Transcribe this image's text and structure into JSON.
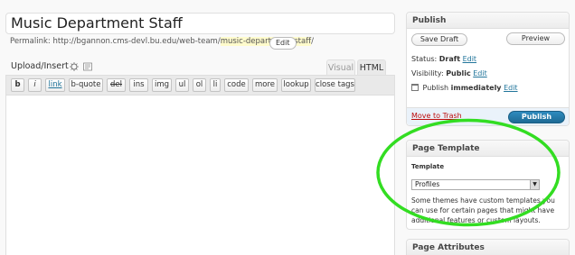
{
  "post": {
    "title": "Music Department Staff",
    "permalink_label": "Permalink:",
    "permalink_base": "http://bgannon.cms-devl.bu.edu/web-team/",
    "permalink_slug": "music-department-staff",
    "permalink_trailing": "/",
    "permalink_edit": "Edit"
  },
  "editor": {
    "upload_label": "Upload/Insert",
    "tabs": [
      "Visual",
      "HTML"
    ],
    "active_tab": "HTML",
    "quicktags": [
      "b",
      "i",
      "link",
      "b-quote",
      "del",
      "ins",
      "img",
      "ul",
      "ol",
      "li",
      "code",
      "more",
      "lookup",
      "close tags"
    ]
  },
  "publish": {
    "heading": "Publish",
    "save_draft": "Save Draft",
    "preview": "Preview",
    "status_label": "Status:",
    "status_value": "Draft",
    "visibility_label": "Visibility:",
    "visibility_value": "Public",
    "schedule_prefix": "Publish",
    "schedule_value": "immediately",
    "edit": "Edit",
    "trash": "Move to Trash",
    "publish_button": "Publish"
  },
  "page_template": {
    "heading": "Page Template",
    "label": "Template",
    "selected": "Profiles",
    "help": "Some themes have custom templates you can use for certain pages that might have additional features or custom layouts."
  },
  "page_attributes": {
    "heading": "Page Attributes"
  },
  "colors": {
    "link": "#21759b",
    "trash": "#bc0b0b",
    "publish_button": "#21759b",
    "annotation_circle": "#33dd22"
  }
}
